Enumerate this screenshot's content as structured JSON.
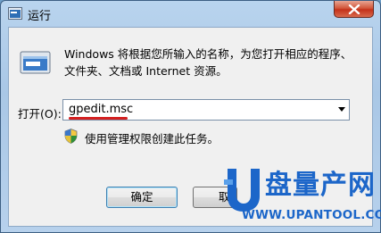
{
  "window": {
    "title": "运行"
  },
  "dialog": {
    "description": "Windows 将根据您所输入的名称，为您打开相应的程序、文件夹、文档或 Internet 资源。",
    "open_label": "打开(O):",
    "command_value": "gpedit.msc",
    "admin_notice": "使用管理权限创建此任务。"
  },
  "buttons": {
    "ok": "确定",
    "cancel_partial": "取"
  },
  "watermark": {
    "brand": "盘量产网",
    "url": "WWW.UPANTOOL.COM"
  },
  "colors": {
    "accent_red": "#d42020",
    "watermark_blue": "#1c66c9",
    "close_red": "#c4321a"
  },
  "icons": [
    "run-icon",
    "close-icon",
    "shield-icon",
    "dropdown-arrow-icon",
    "u-logo-icon"
  ]
}
